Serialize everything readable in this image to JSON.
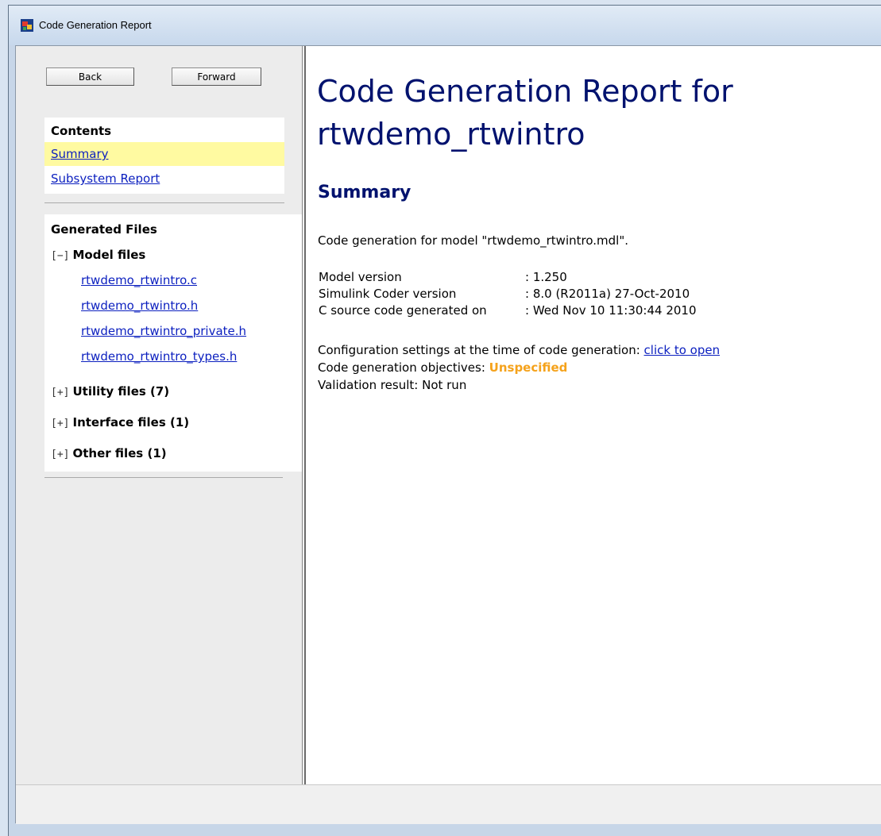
{
  "window": {
    "title": "Code Generation Report"
  },
  "nav": {
    "back_label": "Back",
    "forward_label": "Forward"
  },
  "contents": {
    "heading": "Contents",
    "items": [
      {
        "label": "Summary",
        "active": true
      },
      {
        "label": "Subsystem Report",
        "active": false
      }
    ]
  },
  "files": {
    "heading": "Generated Files",
    "groups": [
      {
        "toggle": "[−]",
        "label": "Model files",
        "files": [
          "rtwdemo_rtwintro.c",
          "rtwdemo_rtwintro.h",
          "rtwdemo_rtwintro_private.h",
          "rtwdemo_rtwintro_types.h"
        ]
      },
      {
        "toggle": "[+]",
        "label": "Utility files (7)"
      },
      {
        "toggle": "[+]",
        "label": "Interface files (1)"
      },
      {
        "toggle": "[+]",
        "label": "Other files (1)"
      }
    ]
  },
  "report": {
    "title": "Code Generation Report for rtwdemo_rtwintro",
    "section": "Summary",
    "intro": "Code generation for model \"rtwdemo_rtwintro.mdl\".",
    "details": [
      {
        "key": "Model version",
        "value": ": 1.250"
      },
      {
        "key": "Simulink Coder version",
        "value": ": 8.0 (R2011a) 27-Oct-2010"
      },
      {
        "key": "C source code generated on",
        "value": ": Wed Nov 10 11:30:44 2010"
      }
    ],
    "config_text": "Configuration settings at the time of code generation: ",
    "config_link": "click to open",
    "objectives_text": "Code generation objectives: ",
    "objectives_value": "Unspecified",
    "validation_text": "Validation result: Not run"
  },
  "colors": {
    "heading": "#00126e",
    "link": "#0b1fbf",
    "active_highlight": "#fffaa1",
    "warning": "#f5a21b"
  },
  "icons": {
    "app": "simulink-app-icon"
  }
}
